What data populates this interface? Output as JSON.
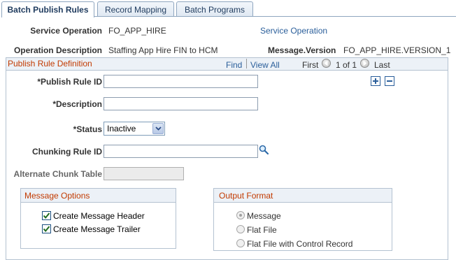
{
  "tabs": [
    {
      "label": "Batch Publish Rules",
      "active": true
    },
    {
      "label": "Record Mapping",
      "active": false
    },
    {
      "label": "Batch Programs",
      "active": false
    }
  ],
  "header": {
    "service_operation_label": "Service Operation",
    "service_operation_value": "FO_APP_HIRE",
    "service_operation_link": "Service Operation",
    "operation_description_label": "Operation Description",
    "operation_description_value": "Staffing App Hire FIN to HCM",
    "message_version_label": "Message.Version",
    "message_version_value": "FO_APP_HIRE.VERSION_1"
  },
  "publish_rule": {
    "title": "Publish Rule Definition",
    "nav": {
      "find": "Find",
      "view_all": "View All",
      "first": "First",
      "position": "1 of 1",
      "last": "Last"
    },
    "fields": {
      "publish_rule_id_label": "*Publish Rule ID",
      "publish_rule_id_value": "",
      "description_label": "*Description",
      "description_value": "",
      "status_label": "*Status",
      "status_value": "Inactive",
      "chunking_rule_id_label": "Chunking Rule ID",
      "chunking_rule_id_value": "",
      "alternate_chunk_table_label": "Alternate Chunk Table",
      "alternate_chunk_table_value": ""
    },
    "message_options": {
      "title": "Message Options",
      "items": [
        {
          "label": "Create Message Header",
          "checked": true
        },
        {
          "label": "Create Message Trailer",
          "checked": true
        }
      ]
    },
    "output_format": {
      "title": "Output Format",
      "options": [
        {
          "label": "Message",
          "selected": true
        },
        {
          "label": "Flat File",
          "selected": false
        },
        {
          "label": "Flat File with Control Record",
          "selected": false
        }
      ]
    }
  },
  "colors": {
    "link": "#2a5e9a",
    "group_title": "#c23a00",
    "border": "#b4c2d1",
    "header_bg": "#ecf1f7"
  }
}
